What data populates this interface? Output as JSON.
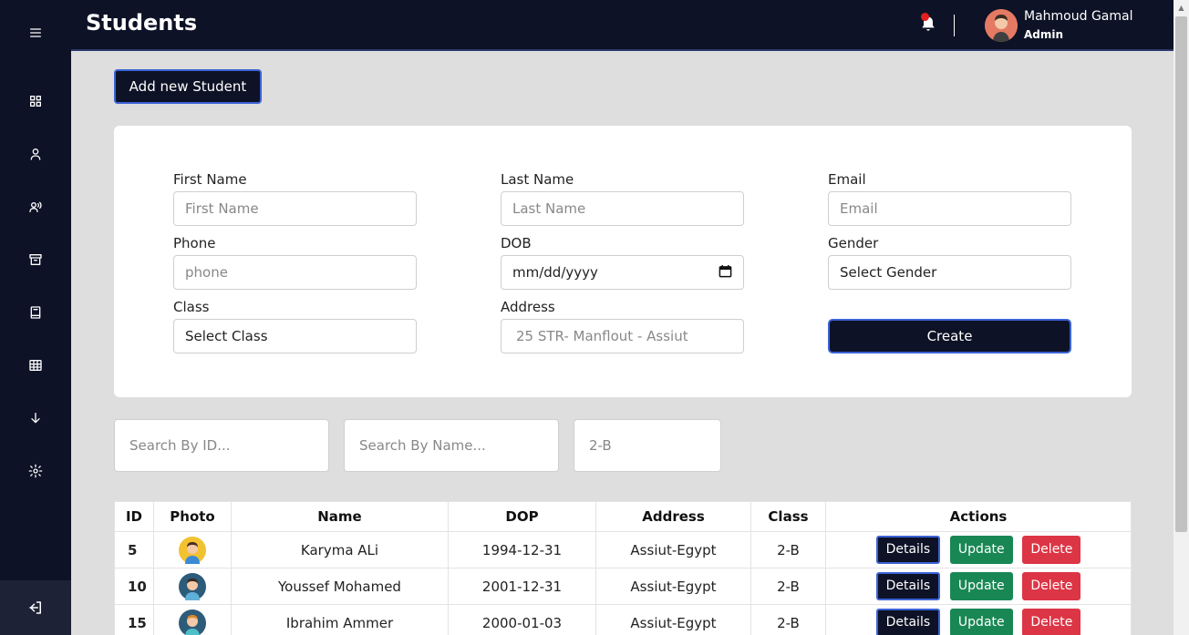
{
  "header": {
    "title": "Students",
    "user_name": "Mahmoud Gamal",
    "user_role": "Admin"
  },
  "sidebar": {
    "items": [
      {
        "icon": "menu-icon"
      },
      {
        "icon": "dashboard-icon"
      },
      {
        "icon": "user-icon"
      },
      {
        "icon": "users-icon"
      },
      {
        "icon": "archive-icon"
      },
      {
        "icon": "book-icon"
      },
      {
        "icon": "table-icon"
      },
      {
        "icon": "arrow-down-icon"
      },
      {
        "icon": "gear-icon"
      }
    ],
    "logout_icon": "logout-icon"
  },
  "toolbar": {
    "add_label": "Add new Student"
  },
  "form": {
    "first_name_label": "First Name",
    "first_name_placeholder": "First Name",
    "last_name_label": "Last Name",
    "last_name_placeholder": "Last Name",
    "email_label": "Email",
    "email_placeholder": "Email",
    "phone_label": "Phone",
    "phone_placeholder": "phone",
    "dob_label": "DOB",
    "dob_placeholder": "mm/dd/yyyy",
    "gender_label": "Gender",
    "gender_value": "Select Gender",
    "class_label": "Class",
    "class_value": "Select Class",
    "address_label": "Address",
    "address_placeholder": "25 STR- Manflout - Assiut",
    "create_label": "Create"
  },
  "search": {
    "id_placeholder": "Search By ID...",
    "name_placeholder": "Search By Name...",
    "class_placeholder": "2-B"
  },
  "table": {
    "headers": [
      "ID",
      "Photo",
      "Name",
      "DOP",
      "Address",
      "Class",
      "Actions"
    ],
    "rows": [
      {
        "id": "5",
        "name": "Karyma ALi",
        "dop": "1994-12-31",
        "address": "Assiut-Egypt",
        "class": "2-B",
        "photo_color": "#f2c230"
      },
      {
        "id": "10",
        "name": "Youssef Mohamed",
        "dop": "2001-12-31",
        "address": "Assiut-Egypt",
        "class": "2-B",
        "photo_color": "#2d5b7a"
      },
      {
        "id": "15",
        "name": "Ibrahim Ammer",
        "dop": "2000-01-03",
        "address": "Assiut-Egypt",
        "class": "2-B",
        "photo_color": "#2d5b7a"
      }
    ],
    "details_label": "Details",
    "update_label": "Update",
    "delete_label": "Delete"
  },
  "colors": {
    "sidebar_bg": "#0d1226",
    "content_bg": "#dedede",
    "accent_border": "#3b63d6",
    "update_green": "#198754",
    "delete_red": "#dc3545",
    "notification_red": "#e41e1e"
  }
}
